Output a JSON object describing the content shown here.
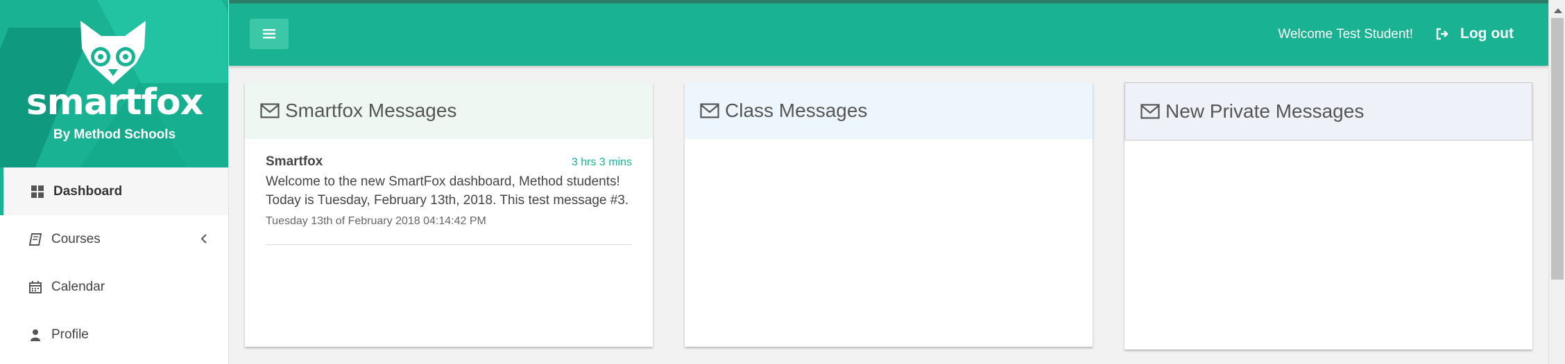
{
  "brand": {
    "name": "smartfox",
    "subtitle": "By Method Schools"
  },
  "sidebar": {
    "items": [
      {
        "label": "Dashboard",
        "icon": "dashboard-icon",
        "active": true
      },
      {
        "label": "Courses",
        "icon": "book-icon",
        "active": false
      },
      {
        "label": "Calendar",
        "icon": "calendar-icon",
        "active": false
      },
      {
        "label": "Profile",
        "icon": "user-icon",
        "active": false
      }
    ]
  },
  "header": {
    "welcome": "Welcome Test Student!",
    "logout": "Log out"
  },
  "panels": [
    {
      "title": "Smartfox Messages",
      "icon": "envelope-icon",
      "messages": [
        {
          "from": "Smartfox",
          "age": "3 hrs 3 mins",
          "body": "Welcome to the new SmartFox dashboard, Method students! Today is Tuesday, February 13th, 2018. This test message #3.",
          "date": "Tuesday 13th of February 2018 04:14:42 PM"
        }
      ]
    },
    {
      "title": "Class Messages",
      "icon": "envelope-icon",
      "messages": []
    },
    {
      "title": "New Private Messages",
      "icon": "envelope-icon",
      "messages": []
    }
  ],
  "colors": {
    "accent": "#19b394",
    "sidebar_bg": "#ffffff",
    "page_bg": "#f2f2f2"
  }
}
